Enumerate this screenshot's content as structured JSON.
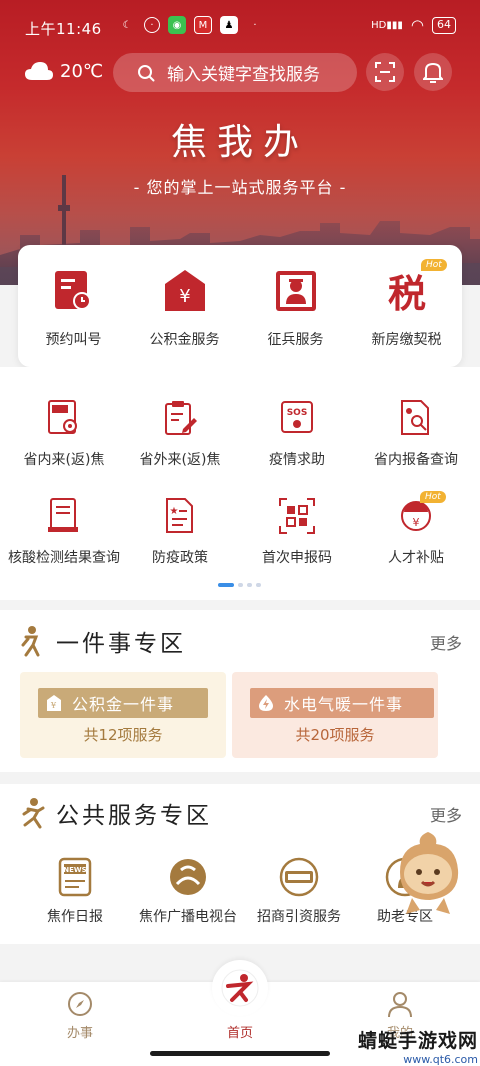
{
  "status_bar": {
    "time": "上午11:46",
    "battery": "64",
    "network": "HD"
  },
  "header": {
    "weather_temp": "20℃",
    "search_placeholder": "输入关键字查找服务",
    "title": "焦我办",
    "subtitle": "- 您的掌上一站式服务平台 -"
  },
  "main_services": [
    {
      "label": "预约叫号",
      "icon": "calendar-clock-icon"
    },
    {
      "label": "公积金服务",
      "icon": "house-yuan-icon"
    },
    {
      "label": "征兵服务",
      "icon": "soldier-icon"
    },
    {
      "label": "新房缴契税",
      "icon": "tax-icon",
      "badge": "Hot"
    }
  ],
  "grid_services": [
    {
      "label": "省内来(返)焦",
      "icon": "report-virus-icon"
    },
    {
      "label": "省外来(返)焦",
      "icon": "clipboard-edit-icon"
    },
    {
      "label": "疫情求助",
      "icon": "sos-icon"
    },
    {
      "label": "省内报备查询",
      "icon": "doc-search-icon"
    },
    {
      "label": "核酸检测结果查询",
      "icon": "test-report-icon"
    },
    {
      "label": "防疫政策",
      "icon": "policy-doc-icon"
    },
    {
      "label": "首次申报码",
      "icon": "qr-scan-icon"
    },
    {
      "label": "人才补贴",
      "icon": "talent-subsidy-icon",
      "badge": "Hot"
    }
  ],
  "one_thing_section": {
    "title": "一件事专区",
    "more": "更多",
    "packs": [
      {
        "tag": "公积金一件事",
        "count": "共12项服务",
        "color": "#c9aa78",
        "bg": "#fbf3e3",
        "text_color": "#a47a3e"
      },
      {
        "tag": "水电气暖一件事",
        "count": "共20项服务",
        "color": "#dc9d7c",
        "bg": "#fbe9e0",
        "text_color": "#b8663a"
      }
    ]
  },
  "public_section": {
    "title": "公共服务专区",
    "more": "更多",
    "items": [
      {
        "label": "焦作日报",
        "icon": "news-icon"
      },
      {
        "label": "焦作广播电视台",
        "icon": "broadcast-logo-icon"
      },
      {
        "label": "招商引资服务",
        "icon": "investment-icon"
      },
      {
        "label": "助老专区",
        "icon": "elder-care-icon"
      }
    ]
  },
  "tabbar": {
    "tab1": "办事",
    "tab2": "首页",
    "tab3": "我的"
  },
  "watermark": {
    "title": "蜻蜓手游戏网",
    "url": "www.qt6.com"
  },
  "colors": {
    "brand_red": "#b8262a",
    "accent_gold": "#f2b232",
    "dot_active": "#3a8ee6"
  }
}
